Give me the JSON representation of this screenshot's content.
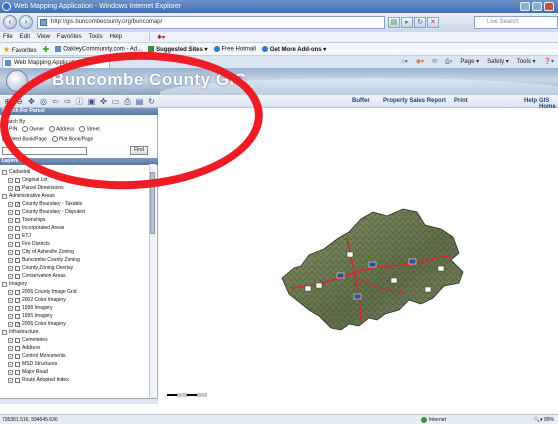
{
  "window": {
    "title": "Web Mapping Application - Windows Internet Explorer"
  },
  "address": {
    "url": "http://gis.buncombecounty.org/buncomap/",
    "search_placeholder": "Live Search"
  },
  "menu": [
    "File",
    "Edit",
    "View",
    "Favorites",
    "Tools",
    "Help"
  ],
  "favorites": {
    "label": "Favorites",
    "items": [
      "OakleyCommunity.com - Ad...",
      "Suggested Sites ▾",
      "Free Hotmail",
      "Get More Add-ons ▾"
    ]
  },
  "tab": {
    "label": "Web Mapping Application"
  },
  "commands": [
    "Page ▾",
    "Safety ▾",
    "Tools ▾"
  ],
  "banner": {
    "title": "Buncombe County GIS"
  },
  "toolbar_links": [
    "Buffer",
    "Property Sales Report",
    "Print",
    "Help",
    "GIS Home"
  ],
  "search_panel": {
    "title": "Search For Parcel",
    "search_by": "Search By:",
    "options_row1": [
      "PIN",
      "Owner",
      "Address",
      "Street"
    ],
    "options_row2": [
      "Deed Book/Page",
      "Plat Book/Page"
    ],
    "find_label": "Find"
  },
  "layers_panel": {
    "title": "Layers",
    "rows": [
      {
        "level": 1,
        "type": "group",
        "label": "Cadastral"
      },
      {
        "level": 2,
        "type": "layer",
        "label": "Original Lot",
        "checked": false
      },
      {
        "level": 2,
        "type": "layer",
        "label": "Parcel Dimensions",
        "checked": true
      },
      {
        "level": 1,
        "type": "group",
        "label": "Administrative Areas"
      },
      {
        "level": 2,
        "type": "layer",
        "label": "County Boundary - Taxable",
        "checked": true
      },
      {
        "level": 2,
        "type": "layer",
        "label": "County Boundary - Disputed",
        "checked": false
      },
      {
        "level": 2,
        "type": "layer",
        "label": "Townships",
        "checked": false
      },
      {
        "level": 2,
        "type": "layer",
        "label": "Incorporated Areas",
        "checked": false
      },
      {
        "level": 2,
        "type": "layer",
        "label": "ETJ",
        "checked": false
      },
      {
        "level": 2,
        "type": "layer",
        "label": "Fire Districts",
        "checked": false
      },
      {
        "level": 2,
        "type": "layer",
        "label": "City of Asheville Zoning",
        "checked": false
      },
      {
        "level": 2,
        "type": "layer",
        "label": "Buncombe County Zoning",
        "checked": false
      },
      {
        "level": 2,
        "type": "layer",
        "label": "County Zoning Overlay",
        "checked": false
      },
      {
        "level": 2,
        "type": "layer",
        "label": "Conservation Areas",
        "checked": false
      },
      {
        "level": 1,
        "type": "group",
        "label": "Imagery"
      },
      {
        "level": 2,
        "type": "layer",
        "label": "2006 County Image Grid",
        "checked": false
      },
      {
        "level": 2,
        "type": "layer",
        "label": "2002 Color Imagery",
        "checked": false
      },
      {
        "level": 2,
        "type": "layer",
        "label": "1998 Imagery",
        "checked": false
      },
      {
        "level": 2,
        "type": "layer",
        "label": "1995 Imagery",
        "checked": false
      },
      {
        "level": 2,
        "type": "layer",
        "label": "2006 Color Imagery",
        "checked": true
      },
      {
        "level": 1,
        "type": "group",
        "label": "Infrastructure"
      },
      {
        "level": 2,
        "type": "layer",
        "label": "Cemeteries",
        "checked": false
      },
      {
        "level": 2,
        "type": "layer",
        "label": "Address",
        "checked": false
      },
      {
        "level": 2,
        "type": "layer",
        "label": "Control Monuments",
        "checked": false
      },
      {
        "level": 2,
        "type": "layer",
        "label": "MSD Structures",
        "checked": false
      },
      {
        "level": 2,
        "type": "layer",
        "label": "Major Road",
        "checked": false
      },
      {
        "level": 2,
        "type": "layer",
        "label": "Route Adopted Index",
        "checked": false
      }
    ]
  },
  "status": {
    "coordinates": "735361.516, 594645.636",
    "zone": "Internet",
    "zoom": "95%"
  },
  "colors": {
    "highlight": "#ee1c24",
    "panel_header": "#5a78a6",
    "road": "#d8252b"
  }
}
